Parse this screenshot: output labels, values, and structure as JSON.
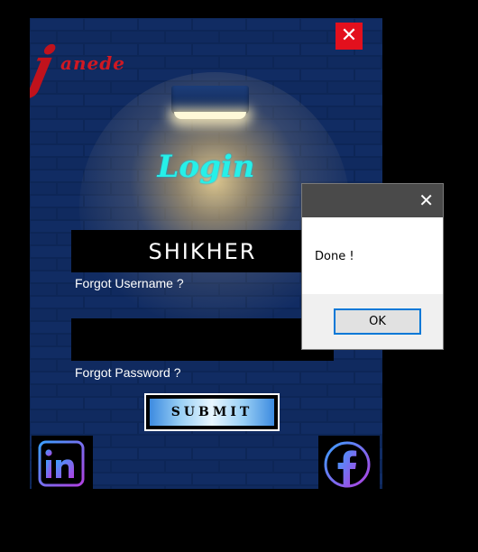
{
  "window": {
    "close_label": "✕",
    "logo": {
      "initial": "j",
      "text": "anede"
    },
    "title": "Login",
    "username_value": "SHIKHER",
    "password_value": "",
    "forgot_username": "Forgot Username  ?",
    "forgot_password": "Forgot Password  ?",
    "submit_label": "SUBMIT",
    "social": {
      "left_icon": "linkedin-icon",
      "right_icon": "facebook-icon"
    },
    "colors": {
      "title": "#26f0e8",
      "logo": "#c0121c",
      "close": "#e3101d",
      "wall": "#0d2a5e"
    }
  },
  "dialog": {
    "close_label": "✕",
    "message": "Done !",
    "ok_label": "OK"
  }
}
